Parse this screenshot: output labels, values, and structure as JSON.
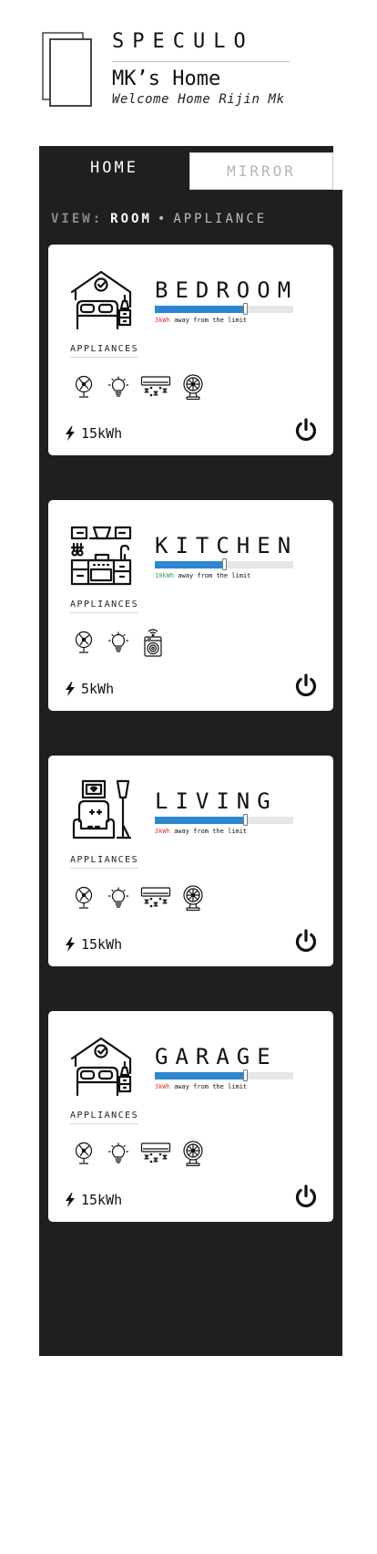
{
  "header": {
    "brand": "SPECULO",
    "home_name": "MK’s Home",
    "welcome": "Welcome Home Rijin Mk"
  },
  "tabs": [
    {
      "label": "HOME",
      "active": true
    },
    {
      "label": "MIRROR",
      "active": false
    }
  ],
  "view": {
    "label": "VIEW:",
    "room": "ROOM",
    "separator": "•",
    "appliance": "APPLIANCE"
  },
  "colors": {
    "panel": "#1f1f20",
    "accent": "#2e86d1",
    "warning": "#e53935",
    "ok": "#2ea84f"
  },
  "rooms": [
    {
      "name": "BEDROOM",
      "icon": "bedroom-icon",
      "usage_fraction": 0.65,
      "limit_value": "3kWh",
      "limit_status": "red",
      "limit_text": "away from the limit",
      "appliances_label": "APPLIANCES",
      "appliances": [
        "ceiling-fan-icon",
        "bulb-icon",
        "air-conditioner-icon",
        "table-fan-icon"
      ],
      "energy": "15kWh"
    },
    {
      "name": "KITCHEN",
      "icon": "kitchen-icon",
      "usage_fraction": 0.5,
      "limit_value": "10kWh",
      "limit_status": "green",
      "limit_text": "away from the limit",
      "appliances_label": "APPLIANCES",
      "appliances": [
        "ceiling-fan-icon",
        "bulb-icon",
        "washing-machine-icon"
      ],
      "energy": "5kWh"
    },
    {
      "name": "LIVING",
      "icon": "living-room-icon",
      "usage_fraction": 0.65,
      "limit_value": "3kWh",
      "limit_status": "red",
      "limit_text": "away from the limit",
      "appliances_label": "APPLIANCES",
      "appliances": [
        "ceiling-fan-icon",
        "bulb-icon",
        "air-conditioner-icon",
        "table-fan-icon"
      ],
      "energy": "15kWh"
    },
    {
      "name": "GARAGE",
      "icon": "bedroom-icon",
      "usage_fraction": 0.65,
      "limit_value": "3kWh",
      "limit_status": "red",
      "limit_text": "away from the limit",
      "appliances_label": "APPLIANCES",
      "appliances": [
        "ceiling-fan-icon",
        "bulb-icon",
        "air-conditioner-icon",
        "table-fan-icon"
      ],
      "energy": "15kWh"
    }
  ]
}
